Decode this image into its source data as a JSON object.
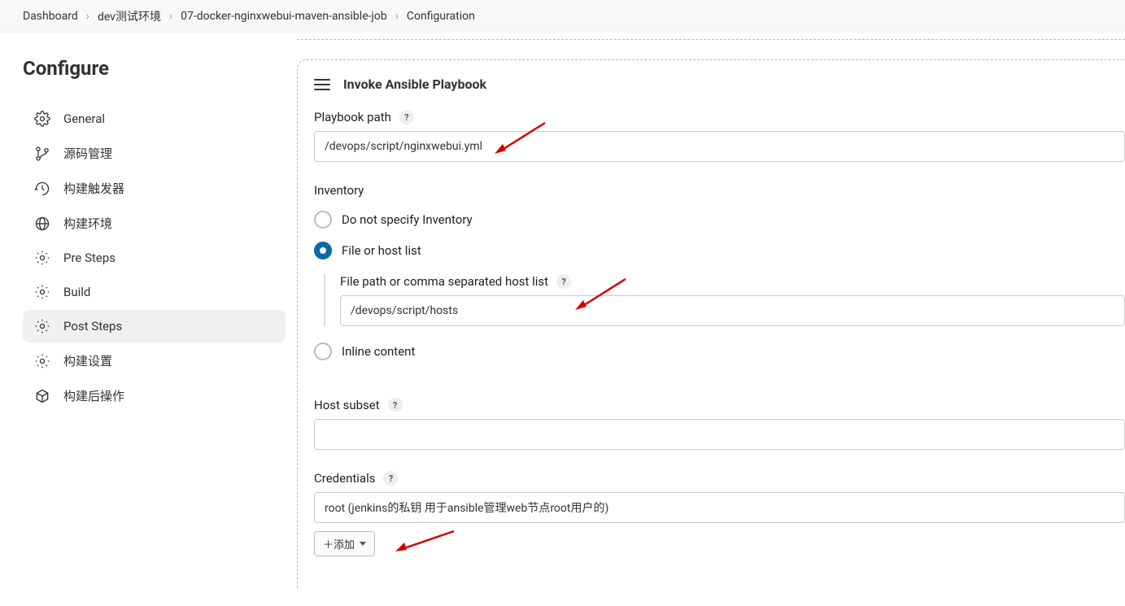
{
  "breadcrumb": {
    "items": [
      "Dashboard",
      "dev测试环境",
      "07-docker-nginxwebui-maven-ansible-job",
      "Configuration"
    ]
  },
  "sidebar": {
    "title": "Configure",
    "items": [
      {
        "id": "general",
        "label": "General"
      },
      {
        "id": "scm",
        "label": "源码管理"
      },
      {
        "id": "triggers",
        "label": "构建触发器"
      },
      {
        "id": "env",
        "label": "构建环境"
      },
      {
        "id": "pre",
        "label": "Pre Steps"
      },
      {
        "id": "build",
        "label": "Build"
      },
      {
        "id": "post",
        "label": "Post Steps"
      },
      {
        "id": "settings",
        "label": "构建设置"
      },
      {
        "id": "postbuild",
        "label": "构建后操作"
      }
    ],
    "active": "post"
  },
  "step": {
    "title": "Invoke Ansible Playbook",
    "playbook": {
      "label": "Playbook path",
      "value": "/devops/script/nginxwebui.yml"
    },
    "inventory": {
      "label": "Inventory",
      "options": {
        "none": "Do not specify Inventory",
        "file": "File or host list",
        "inline": "Inline content"
      },
      "selected": "file",
      "file": {
        "label": "File path or comma separated host list",
        "value": "/devops/script/hosts"
      }
    },
    "hostSubset": {
      "label": "Host subset",
      "value": ""
    },
    "credentials": {
      "label": "Credentials",
      "value": "root (jenkins的私钥 用于ansible管理web节点root用户的)"
    },
    "addButton": "添加"
  }
}
